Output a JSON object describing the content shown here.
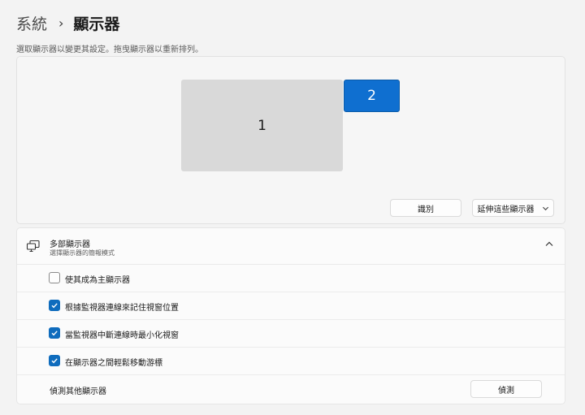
{
  "breadcrumb": {
    "parent": "系統",
    "separator": "›",
    "current": "顯示器"
  },
  "arrange": {
    "hint": "選取顯示器以變更其設定。拖曳顯示器以重新排列。",
    "monitors": [
      {
        "label": "1",
        "selected": false
      },
      {
        "label": "2",
        "selected": true
      }
    ],
    "identify_label": "識別",
    "mode_select_value": "延伸這些顯示器"
  },
  "multi_display": {
    "title": "多部顯示器",
    "subtitle": "選擇顯示器的簡報模式",
    "expanded": true,
    "options": [
      {
        "label": "使其成為主顯示器",
        "checked": false
      },
      {
        "label": "根據監視器連線來記住視窗位置",
        "checked": true
      },
      {
        "label": "當監視器中斷連線時最小化視窗",
        "checked": true
      },
      {
        "label": "在顯示器之間輕鬆移動游標",
        "checked": true
      }
    ],
    "detect": {
      "label": "偵測其他顯示器",
      "button": "偵測"
    }
  },
  "colors": {
    "accent": "#0f6cbd",
    "selected_monitor": "#0f6fd0",
    "unselected_monitor": "#d9d9d9"
  },
  "icons": {
    "multi_display": "multiple-displays-icon",
    "collapse": "chevron-up-icon",
    "dropdown": "chevron-down-icon",
    "check": "checkmark-icon"
  }
}
